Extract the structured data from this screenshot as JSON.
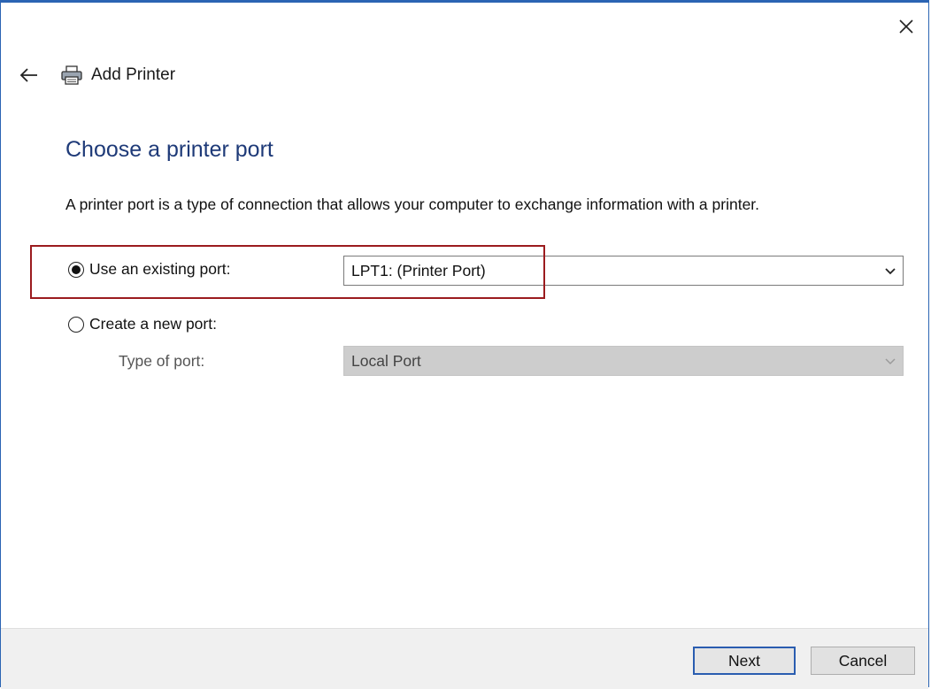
{
  "window": {
    "title": "Add Printer",
    "close_icon": "close-icon",
    "back_icon": "back-arrow-icon",
    "title_icon": "printer-icon"
  },
  "page": {
    "heading": "Choose a printer port",
    "description": "A printer port is a type of connection that allows your computer to exchange information with a printer."
  },
  "options": {
    "existing": {
      "label": "Use an existing port:",
      "selected": true,
      "dropdown_value": "LPT1: (Printer Port)"
    },
    "new": {
      "label": "Create a new port:",
      "selected": false,
      "type_label": "Type of port:",
      "type_value": "Local Port",
      "disabled": true
    }
  },
  "footer": {
    "next_label": "Next",
    "cancel_label": "Cancel"
  },
  "colors": {
    "heading": "#1e3a78",
    "highlight_box": "#9b1b1e",
    "window_border": "#2b64b3"
  }
}
